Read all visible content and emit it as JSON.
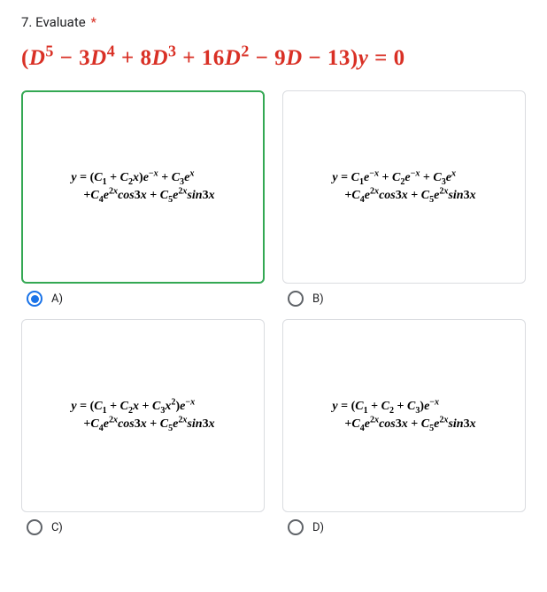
{
  "question": {
    "number_label": "7. Evaluate",
    "required_mark": "*",
    "equation_html": "(<i>D</i><sup>5</sup> − 3<i>D</i><sup>4</sup> + 8<i>D</i><sup>3</sup> + 16<i>D</i><sup>2</sup> − 9<i>D</i> − 13)<i>y</i> = 0"
  },
  "options": [
    {
      "key": "A",
      "label": "A)",
      "selected": true,
      "formula_html": "<i>y</i> = (<i>C</i><sub>1</sub> + <i>C</i><sub>2</sub><i>x</i>)<i>e</i><sup>−<i>x</i></sup> + <i>C</i><sub>3</sub><i>e</i><sup><i>x</i></sup><br>&nbsp;&nbsp;&nbsp;&nbsp;+<i>C</i><sub>4</sub><i>e</i><sup>2<i>x</i></sup><i>cos</i>3<i>x</i> + <i>C</i><sub>5</sub><i>e</i><sup>2<i>x</i></sup><i>sin</i>3<i>x</i>"
    },
    {
      "key": "B",
      "label": "B)",
      "selected": false,
      "formula_html": "<i>y</i> = <i>C</i><sub>1</sub><i>e</i><sup>−<i>x</i></sup> + <i>C</i><sub>2</sub><i>e</i><sup>−<i>x</i></sup> + <i>C</i><sub>3</sub><i>e</i><sup><i>x</i></sup><br>&nbsp;&nbsp;&nbsp;&nbsp;+<i>C</i><sub>4</sub><i>e</i><sup>2<i>x</i></sup><i>cos</i>3<i>x</i> + <i>C</i><sub>5</sub><i>e</i><sup>2<i>x</i></sup><i>sin</i>3<i>x</i>"
    },
    {
      "key": "C",
      "label": "C)",
      "selected": false,
      "formula_html": "<i>y</i> = (<i>C</i><sub>1</sub> + <i>C</i><sub>2</sub><i>x</i> + <i>C</i><sub>3</sub><i>x</i><sup>2</sup>)<i>e</i><sup>−<i>x</i></sup><br>&nbsp;&nbsp;&nbsp;&nbsp;+<i>C</i><sub>4</sub><i>e</i><sup>2<i>x</i></sup><i>cos</i>3<i>x</i> + <i>C</i><sub>5</sub><i>e</i><sup>2<i>x</i></sup><i>sin</i>3<i>x</i>"
    },
    {
      "key": "D",
      "label": "D)",
      "selected": false,
      "formula_html": "<i>y</i> = (<i>C</i><sub>1</sub> + <i>C</i><sub>2</sub> + <i>C</i><sub>3</sub>)<i>e</i><sup>−<i>x</i></sup><br>&nbsp;&nbsp;&nbsp;&nbsp;+<i>C</i><sub>4</sub><i>e</i><sup>2<i>x</i></sup><i>cos</i>3<i>x</i> + <i>C</i><sub>5</sub><i>e</i><sup>2<i>x</i></sup><i>sin</i>3<i>x</i>"
    }
  ]
}
